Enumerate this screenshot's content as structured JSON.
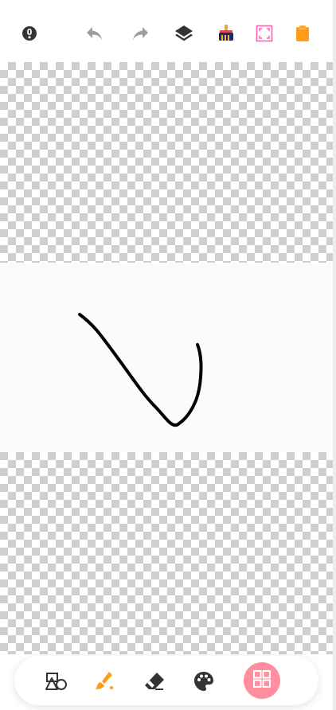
{
  "top_toolbar": {
    "icons": [
      {
        "name": "info-icon",
        "color": "#333333"
      },
      {
        "name": "undo-icon",
        "color": "#9e9e9e"
      },
      {
        "name": "redo-icon",
        "color": "#9e9e9e"
      },
      {
        "name": "layers-icon",
        "color": "#333333"
      },
      {
        "name": "paint-bucket-icon",
        "color": "#1f2a6b"
      },
      {
        "name": "fullscreen-icon",
        "color": "#ff5fb0"
      },
      {
        "name": "clipboard-icon",
        "color": "#ff9c1a"
      }
    ]
  },
  "canvas": {
    "background": "transparent-checkerboard",
    "stroke_color": "#000000"
  },
  "bottom_toolbar": {
    "tools": [
      {
        "name": "shapes-icon",
        "color": "#333333"
      },
      {
        "name": "brush-icon",
        "color": "#ff9c1a"
      },
      {
        "name": "eraser-icon",
        "color": "#333333"
      },
      {
        "name": "palette-icon",
        "color": "#333333"
      },
      {
        "name": "grid-menu-icon",
        "color": "#ffffff",
        "background": "#ff8e9e"
      }
    ]
  }
}
